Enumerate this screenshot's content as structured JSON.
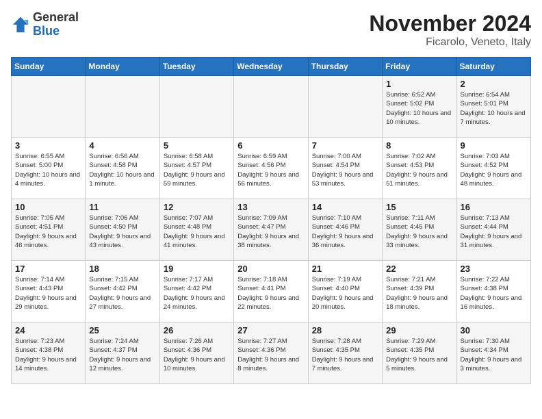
{
  "logo": {
    "general": "General",
    "blue": "Blue"
  },
  "title": "November 2024",
  "subtitle": "Ficarolo, Veneto, Italy",
  "days_header": [
    "Sunday",
    "Monday",
    "Tuesday",
    "Wednesday",
    "Thursday",
    "Friday",
    "Saturday"
  ],
  "weeks": [
    [
      {
        "day": "",
        "info": ""
      },
      {
        "day": "",
        "info": ""
      },
      {
        "day": "",
        "info": ""
      },
      {
        "day": "",
        "info": ""
      },
      {
        "day": "",
        "info": ""
      },
      {
        "day": "1",
        "info": "Sunrise: 6:52 AM\nSunset: 5:02 PM\nDaylight: 10 hours and 10 minutes."
      },
      {
        "day": "2",
        "info": "Sunrise: 6:54 AM\nSunset: 5:01 PM\nDaylight: 10 hours and 7 minutes."
      }
    ],
    [
      {
        "day": "3",
        "info": "Sunrise: 6:55 AM\nSunset: 5:00 PM\nDaylight: 10 hours and 4 minutes."
      },
      {
        "day": "4",
        "info": "Sunrise: 6:56 AM\nSunset: 4:58 PM\nDaylight: 10 hours and 1 minute."
      },
      {
        "day": "5",
        "info": "Sunrise: 6:58 AM\nSunset: 4:57 PM\nDaylight: 9 hours and 59 minutes."
      },
      {
        "day": "6",
        "info": "Sunrise: 6:59 AM\nSunset: 4:56 PM\nDaylight: 9 hours and 56 minutes."
      },
      {
        "day": "7",
        "info": "Sunrise: 7:00 AM\nSunset: 4:54 PM\nDaylight: 9 hours and 53 minutes."
      },
      {
        "day": "8",
        "info": "Sunrise: 7:02 AM\nSunset: 4:53 PM\nDaylight: 9 hours and 51 minutes."
      },
      {
        "day": "9",
        "info": "Sunrise: 7:03 AM\nSunset: 4:52 PM\nDaylight: 9 hours and 48 minutes."
      }
    ],
    [
      {
        "day": "10",
        "info": "Sunrise: 7:05 AM\nSunset: 4:51 PM\nDaylight: 9 hours and 46 minutes."
      },
      {
        "day": "11",
        "info": "Sunrise: 7:06 AM\nSunset: 4:50 PM\nDaylight: 9 hours and 43 minutes."
      },
      {
        "day": "12",
        "info": "Sunrise: 7:07 AM\nSunset: 4:48 PM\nDaylight: 9 hours and 41 minutes."
      },
      {
        "day": "13",
        "info": "Sunrise: 7:09 AM\nSunset: 4:47 PM\nDaylight: 9 hours and 38 minutes."
      },
      {
        "day": "14",
        "info": "Sunrise: 7:10 AM\nSunset: 4:46 PM\nDaylight: 9 hours and 36 minutes."
      },
      {
        "day": "15",
        "info": "Sunrise: 7:11 AM\nSunset: 4:45 PM\nDaylight: 9 hours and 33 minutes."
      },
      {
        "day": "16",
        "info": "Sunrise: 7:13 AM\nSunset: 4:44 PM\nDaylight: 9 hours and 31 minutes."
      }
    ],
    [
      {
        "day": "17",
        "info": "Sunrise: 7:14 AM\nSunset: 4:43 PM\nDaylight: 9 hours and 29 minutes."
      },
      {
        "day": "18",
        "info": "Sunrise: 7:15 AM\nSunset: 4:42 PM\nDaylight: 9 hours and 27 minutes."
      },
      {
        "day": "19",
        "info": "Sunrise: 7:17 AM\nSunset: 4:42 PM\nDaylight: 9 hours and 24 minutes."
      },
      {
        "day": "20",
        "info": "Sunrise: 7:18 AM\nSunset: 4:41 PM\nDaylight: 9 hours and 22 minutes."
      },
      {
        "day": "21",
        "info": "Sunrise: 7:19 AM\nSunset: 4:40 PM\nDaylight: 9 hours and 20 minutes."
      },
      {
        "day": "22",
        "info": "Sunrise: 7:21 AM\nSunset: 4:39 PM\nDaylight: 9 hours and 18 minutes."
      },
      {
        "day": "23",
        "info": "Sunrise: 7:22 AM\nSunset: 4:38 PM\nDaylight: 9 hours and 16 minutes."
      }
    ],
    [
      {
        "day": "24",
        "info": "Sunrise: 7:23 AM\nSunset: 4:38 PM\nDaylight: 9 hours and 14 minutes."
      },
      {
        "day": "25",
        "info": "Sunrise: 7:24 AM\nSunset: 4:37 PM\nDaylight: 9 hours and 12 minutes."
      },
      {
        "day": "26",
        "info": "Sunrise: 7:26 AM\nSunset: 4:36 PM\nDaylight: 9 hours and 10 minutes."
      },
      {
        "day": "27",
        "info": "Sunrise: 7:27 AM\nSunset: 4:36 PM\nDaylight: 9 hours and 8 minutes."
      },
      {
        "day": "28",
        "info": "Sunrise: 7:28 AM\nSunset: 4:35 PM\nDaylight: 9 hours and 7 minutes."
      },
      {
        "day": "29",
        "info": "Sunrise: 7:29 AM\nSunset: 4:35 PM\nDaylight: 9 hours and 5 minutes."
      },
      {
        "day": "30",
        "info": "Sunrise: 7:30 AM\nSunset: 4:34 PM\nDaylight: 9 hours and 3 minutes."
      }
    ]
  ]
}
